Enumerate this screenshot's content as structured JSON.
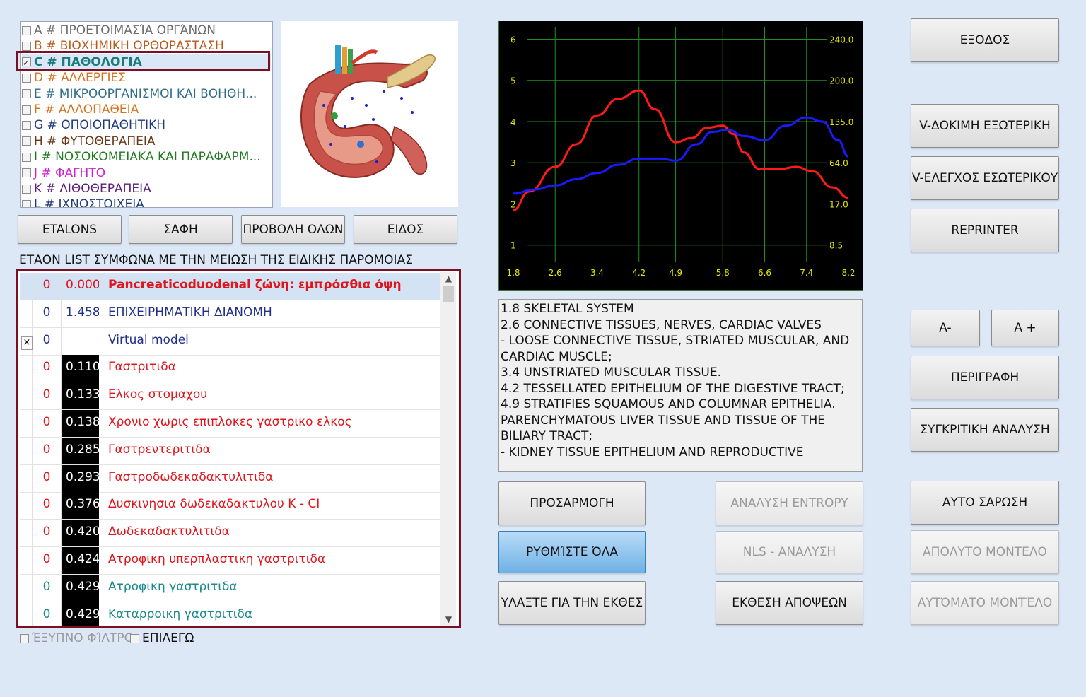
{
  "categories": {
    "items": [
      {
        "label": "A # ΠΡΟΕΤΟΙΜΑΣΊΑ ΟΡΓΆΝΩΝ",
        "color": "#6b6b6b",
        "checked": false
      },
      {
        "label": "B # ΒΙΟΧΗΜΙΚΗ ΟΡΘΟΡΑΣΤΑΣΗ",
        "color": "#b85a1c",
        "checked": false
      },
      {
        "label": "C # ΠΑΘΟΛΟΓΙΑ",
        "color": "#1b7a7a",
        "checked": true
      },
      {
        "label": "D # ΑΛΛΕΡΓΙΕΣ",
        "color": "#d4731c",
        "checked": false
      },
      {
        "label": "E # ΜΙΚΡΟΟΡΓΑΝΙΣΜΟΙ ΚΑΙ ΒΟΗΘΗ...",
        "color": "#2f6d8c",
        "checked": false
      },
      {
        "label": "F # ΑΛΛΟΠΑΘΕΙΑ",
        "color": "#d4731c",
        "checked": false
      },
      {
        "label": "G # ΟΠΟΙΟΠΑΘΗΤΙΚΗ",
        "color": "#1f3c7a",
        "checked": false
      },
      {
        "label": "H # ΦΥΤΟΘΕΡΑΠΕΙΑ",
        "color": "#6b3a1a",
        "checked": false
      },
      {
        "label": "I # ΝΟΣΟΚΟΜΕΙΑΚΑ ΚΑΙ ΠΑΡΑΦΑΡΜ...",
        "color": "#1f7a1f",
        "checked": false
      },
      {
        "label": "J # ΦΑΓΗΤΟ",
        "color": "#d020d0",
        "checked": false
      },
      {
        "label": "K # ΛΙΘΟΘΕΡΑΠΕΙΑ",
        "color": "#5a1f7a",
        "checked": false
      },
      {
        "label": "L # ΙΧΝΟΣΤΟΙΧΕΙΑ",
        "color": "#1f3c7a",
        "checked": false
      }
    ]
  },
  "buttons": {
    "etalons": "ETALONS",
    "clarity": "ΣΑΦΗ",
    "show_all": "ΠΡΟΒΟΛΗ ΟΛΩΝ",
    "kind": "ΕΙΔΟΣ",
    "exit": "ΕΞΟΔΟΣ",
    "v_test_external": "V-ΔΟΚΙΜΗ ΕΞΩΤΕΡΙΚΗ",
    "v_check_internal": "V-ΕΛΕΓΧΟΣ ΕΣΩΤΕΡΙΚΟΥ",
    "reprinter": "REPRINTER",
    "a_minus": "A-",
    "a_plus": "A +",
    "description": "ΠΕΡΙΓΡΑΦΗ",
    "comparative": "ΣΥΓΚΡΙΤΙΚΗ ΑΝΑΛΥΣΗ",
    "adjust": "ΠΡΟΣΑΡΜΟΓΗ",
    "entropy": "ΑΝΑΛΥΣΗ ENTROPY",
    "auto_scan": "ΑΥΤΟ ΣΑΡΩΣΗ",
    "set_all": "ΡΥΘΜΊΣΤΕ ΌΛΑ",
    "nls": "NLS - ΑΝΑΛΥΣΗ",
    "absolute_model": "ΑΠΟΛΥΤΟ ΜΟΝΤΕΛΟ",
    "report_search": "ΥΛΑΞΤΕ ΓΙΑ ΤΗΝ ΕΚΘΕΣ",
    "opinion_report": "ΕΚΘΕΣΗ ΑΠΟΨΕΩΝ",
    "automatic_model": "ΑΥΤΌΜΑΤΟ ΜΟΝΤΈΛΟ"
  },
  "etalon_caption": "ΕΤΑΟΝ LIST ΣΥΜΦΩΝΑ ΜΕ ΤΗΝ ΜΕΙΩΣΗ ΤΗΣ ΕΙΔΙΚΗΣ ΠΑΡΟΜΟΙΑΣ",
  "etalon_list": [
    {
      "x": "",
      "n": "0",
      "value": "0.000",
      "name": "Pancreaticoduodenal ζώνη: εμπρόσθια όψη",
      "color": "#e0141b",
      "bold": true,
      "dark": false,
      "selected": true
    },
    {
      "x": "",
      "n": "0",
      "value": "1.458",
      "name": "ΕΠΙΧΕΙΡΗΜΑΤΙΚΗ ΔΙΑΝΟΜΗ",
      "color": "#1f2f8a",
      "bold": false,
      "dark": false,
      "selected": false
    },
    {
      "x": "×",
      "n": "0",
      "value": "",
      "name": "Virtual model",
      "color": "#1f2f8a",
      "bold": false,
      "dark": false,
      "selected": false
    },
    {
      "x": "",
      "n": "0",
      "value": "0.110",
      "name": "Γαστριτιδα",
      "color": "#e0141b",
      "bold": false,
      "dark": true,
      "selected": false
    },
    {
      "x": "",
      "n": "0",
      "value": "0.133",
      "name": "Ελκος στομαχου",
      "color": "#e0141b",
      "bold": false,
      "dark": true,
      "selected": false
    },
    {
      "x": "",
      "n": "0",
      "value": "0.138",
      "name": "Χρονιο χωρις επιπλοκες γαστρικο ελκος",
      "color": "#e0141b",
      "bold": false,
      "dark": true,
      "selected": false
    },
    {
      "x": "",
      "n": "0",
      "value": "0.285",
      "name": "Γαστρεντεριτιδα",
      "color": "#e0141b",
      "bold": false,
      "dark": true,
      "selected": false
    },
    {
      "x": "",
      "n": "0",
      "value": "0.293",
      "name": "Γαστροδωδεκαδακτυλιτιδα",
      "color": "#e0141b",
      "bold": false,
      "dark": true,
      "selected": false
    },
    {
      "x": "",
      "n": "0",
      "value": "0.376",
      "name": "Δυσκινησια δωδεκαδακτυλου Κ - CI",
      "color": "#e0141b",
      "bold": false,
      "dark": true,
      "selected": false
    },
    {
      "x": "",
      "n": "0",
      "value": "0.420",
      "name": "Δωδεκαδακτυλιτιδα",
      "color": "#e0141b",
      "bold": false,
      "dark": true,
      "selected": false
    },
    {
      "x": "",
      "n": "0",
      "value": "0.424",
      "name": "Ατροφικη υπερπλαστικη γαστριτιδα",
      "color": "#e0141b",
      "bold": false,
      "dark": true,
      "selected": false
    },
    {
      "x": "",
      "n": "0",
      "value": "0.429",
      "name": "Ατροφικη γαστριτιδα",
      "color": "#1b8a8a",
      "bold": false,
      "dark": true,
      "selected": false
    },
    {
      "x": "",
      "n": "0",
      "value": "0.429",
      "name": "Καταρροικη γαστριτιδα",
      "color": "#1b8a8a",
      "bold": false,
      "dark": true,
      "selected": false
    }
  ],
  "bottom_checks": {
    "smart_filter": "ΈΞΥΠΝΟ ΦΊΛΤΡΟ",
    "select": "ΕΠΙΛΕΓΩ"
  },
  "info_text": "1.8 SKELETAL SYSTEM\n2.6 CONNECTIVE TISSUES, NERVES, CARDIAC VALVES\n- LOOSE CONNECTIVE TISSUE, STRIATED MUSCULAR, AND CARDIAC MUSCLE;\n3.4 UNSTRIATED MUSCULAR TISSUE.\n4.2 TESSELLATED EPITHELIUM OF THE DIGESTIVE TRACT;\n4.9 STRATIFIES SQUAMOUS AND COLUMNAR EPITHELIA. PARENCHYMATOUS LIVER TISSUE AND TISSUE OF THE BILIARY TRACT;\n- KIDNEY TISSUE EPITHELIUM AND REPRODUCTIVE",
  "chart_data": {
    "type": "line",
    "x_ticks": [
      "1.8",
      "2.6",
      "3.4",
      "4.2",
      "4.9",
      "5.8",
      "6.6",
      "7.4",
      "8.2"
    ],
    "y_ticks_left": [
      "1",
      "2",
      "3",
      "4",
      "5",
      "6"
    ],
    "y_ticks_right": [
      "8.5",
      "17.0",
      "64.0",
      "135.0",
      "200.0",
      "240.0"
    ],
    "xlim": [
      1.8,
      8.2
    ],
    "ylim": [
      0.6,
      6.3
    ],
    "grid": true,
    "background": "#000000",
    "grid_color": "#1f8f1f",
    "label_color": "#e6e600",
    "series": [
      {
        "color": "#ff1a1a",
        "x": [
          1.8,
          2.1,
          2.6,
          3.0,
          3.4,
          3.8,
          4.2,
          4.5,
          4.9,
          5.2,
          5.5,
          5.8,
          6.0,
          6.2,
          6.5,
          6.9,
          7.2,
          7.5,
          7.9,
          8.2
        ],
        "y": [
          1.85,
          2.3,
          2.9,
          3.45,
          4.15,
          4.55,
          4.75,
          4.3,
          3.5,
          3.6,
          3.85,
          3.9,
          3.7,
          3.25,
          2.85,
          2.85,
          2.9,
          2.8,
          2.4,
          2.15
        ]
      },
      {
        "color": "#1a1aff",
        "x": [
          1.8,
          2.2,
          2.6,
          3.0,
          3.4,
          3.8,
          4.2,
          4.6,
          4.9,
          5.3,
          5.6,
          5.9,
          6.2,
          6.6,
          7.0,
          7.4,
          7.7,
          8.0,
          8.2
        ],
        "y": [
          2.25,
          2.35,
          2.45,
          2.6,
          2.75,
          2.95,
          3.1,
          3.1,
          3.05,
          3.45,
          3.75,
          3.8,
          3.65,
          3.55,
          3.9,
          4.1,
          4.0,
          3.55,
          3.15
        ]
      }
    ]
  }
}
